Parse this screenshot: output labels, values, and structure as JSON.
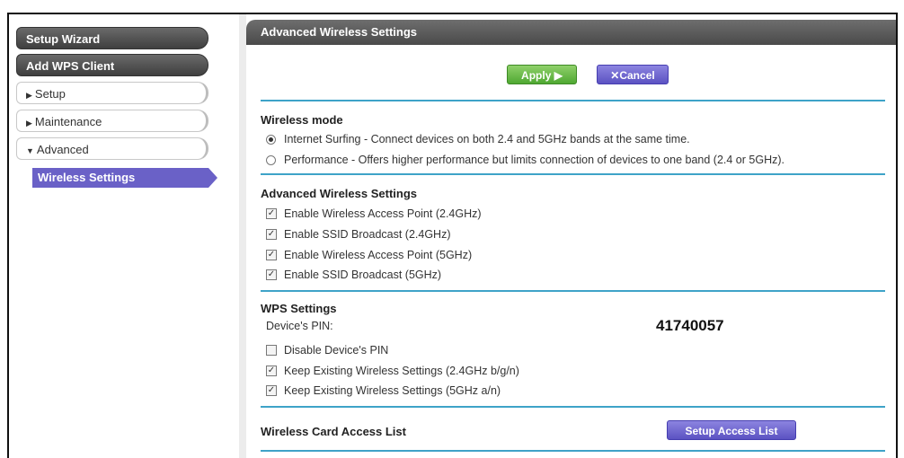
{
  "sidebar": {
    "setup_wizard": "Setup Wizard",
    "add_wps_client": "Add WPS Client",
    "setup": "Setup",
    "maintenance": "Maintenance",
    "advanced": "Advanced",
    "wireless_settings": "Wireless Settings"
  },
  "header": {
    "title": "Advanced Wireless Settings"
  },
  "toolbar": {
    "apply_label": "Apply ▶",
    "cancel_label": "Cancel"
  },
  "wireless_mode": {
    "title": "Wireless mode",
    "options": [
      {
        "label": "Internet Surfing - Connect devices on both 2.4 and 5GHz bands at the same time.",
        "selected": true
      },
      {
        "label": "Performance - Offers higher performance but limits connection of devices to one band (2.4 or 5GHz).",
        "selected": false
      }
    ]
  },
  "advanced_wireless": {
    "title": "Advanced Wireless Settings",
    "items": [
      {
        "label": "Enable Wireless Access Point (2.4GHz)",
        "checked": true
      },
      {
        "label": "Enable SSID Broadcast (2.4GHz)",
        "checked": true
      },
      {
        "label": "Enable Wireless Access Point (5GHz)",
        "checked": true
      },
      {
        "label": "Enable SSID Broadcast (5GHz)",
        "checked": true
      }
    ]
  },
  "wps": {
    "title": "WPS Settings",
    "pin_label": "Device's PIN:",
    "pin_value": "41740057",
    "items": [
      {
        "label": "Disable Device's PIN",
        "checked": false
      },
      {
        "label": "Keep Existing Wireless Settings (2.4GHz b/g/n)",
        "checked": true
      },
      {
        "label": "Keep Existing Wireless Settings (5GHz a/n)",
        "checked": true
      }
    ]
  },
  "access_list": {
    "title": "Wireless Card Access List",
    "button_label": "Setup Access List"
  },
  "colors": {
    "accent_blue": "#3ea3c8",
    "purple": "#6a61c7",
    "green": "#4fa832"
  }
}
